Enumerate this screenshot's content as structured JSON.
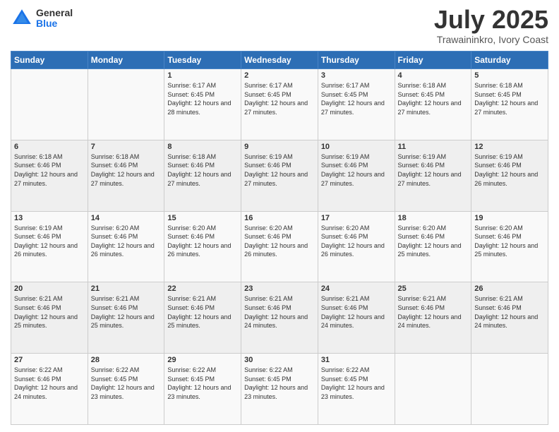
{
  "header": {
    "logo_general": "General",
    "logo_blue": "Blue",
    "month_title": "July 2025",
    "location": "Trawaininkro, Ivory Coast"
  },
  "calendar": {
    "days_of_week": [
      "Sunday",
      "Monday",
      "Tuesday",
      "Wednesday",
      "Thursday",
      "Friday",
      "Saturday"
    ],
    "weeks": [
      [
        {
          "day": "",
          "info": ""
        },
        {
          "day": "",
          "info": ""
        },
        {
          "day": "1",
          "info": "Sunrise: 6:17 AM\nSunset: 6:45 PM\nDaylight: 12 hours and 28 minutes."
        },
        {
          "day": "2",
          "info": "Sunrise: 6:17 AM\nSunset: 6:45 PM\nDaylight: 12 hours and 27 minutes."
        },
        {
          "day": "3",
          "info": "Sunrise: 6:17 AM\nSunset: 6:45 PM\nDaylight: 12 hours and 27 minutes."
        },
        {
          "day": "4",
          "info": "Sunrise: 6:18 AM\nSunset: 6:45 PM\nDaylight: 12 hours and 27 minutes."
        },
        {
          "day": "5",
          "info": "Sunrise: 6:18 AM\nSunset: 6:45 PM\nDaylight: 12 hours and 27 minutes."
        }
      ],
      [
        {
          "day": "6",
          "info": "Sunrise: 6:18 AM\nSunset: 6:46 PM\nDaylight: 12 hours and 27 minutes."
        },
        {
          "day": "7",
          "info": "Sunrise: 6:18 AM\nSunset: 6:46 PM\nDaylight: 12 hours and 27 minutes."
        },
        {
          "day": "8",
          "info": "Sunrise: 6:18 AM\nSunset: 6:46 PM\nDaylight: 12 hours and 27 minutes."
        },
        {
          "day": "9",
          "info": "Sunrise: 6:19 AM\nSunset: 6:46 PM\nDaylight: 12 hours and 27 minutes."
        },
        {
          "day": "10",
          "info": "Sunrise: 6:19 AM\nSunset: 6:46 PM\nDaylight: 12 hours and 27 minutes."
        },
        {
          "day": "11",
          "info": "Sunrise: 6:19 AM\nSunset: 6:46 PM\nDaylight: 12 hours and 27 minutes."
        },
        {
          "day": "12",
          "info": "Sunrise: 6:19 AM\nSunset: 6:46 PM\nDaylight: 12 hours and 26 minutes."
        }
      ],
      [
        {
          "day": "13",
          "info": "Sunrise: 6:19 AM\nSunset: 6:46 PM\nDaylight: 12 hours and 26 minutes."
        },
        {
          "day": "14",
          "info": "Sunrise: 6:20 AM\nSunset: 6:46 PM\nDaylight: 12 hours and 26 minutes."
        },
        {
          "day": "15",
          "info": "Sunrise: 6:20 AM\nSunset: 6:46 PM\nDaylight: 12 hours and 26 minutes."
        },
        {
          "day": "16",
          "info": "Sunrise: 6:20 AM\nSunset: 6:46 PM\nDaylight: 12 hours and 26 minutes."
        },
        {
          "day": "17",
          "info": "Sunrise: 6:20 AM\nSunset: 6:46 PM\nDaylight: 12 hours and 26 minutes."
        },
        {
          "day": "18",
          "info": "Sunrise: 6:20 AM\nSunset: 6:46 PM\nDaylight: 12 hours and 25 minutes."
        },
        {
          "day": "19",
          "info": "Sunrise: 6:20 AM\nSunset: 6:46 PM\nDaylight: 12 hours and 25 minutes."
        }
      ],
      [
        {
          "day": "20",
          "info": "Sunrise: 6:21 AM\nSunset: 6:46 PM\nDaylight: 12 hours and 25 minutes."
        },
        {
          "day": "21",
          "info": "Sunrise: 6:21 AM\nSunset: 6:46 PM\nDaylight: 12 hours and 25 minutes."
        },
        {
          "day": "22",
          "info": "Sunrise: 6:21 AM\nSunset: 6:46 PM\nDaylight: 12 hours and 25 minutes."
        },
        {
          "day": "23",
          "info": "Sunrise: 6:21 AM\nSunset: 6:46 PM\nDaylight: 12 hours and 24 minutes."
        },
        {
          "day": "24",
          "info": "Sunrise: 6:21 AM\nSunset: 6:46 PM\nDaylight: 12 hours and 24 minutes."
        },
        {
          "day": "25",
          "info": "Sunrise: 6:21 AM\nSunset: 6:46 PM\nDaylight: 12 hours and 24 minutes."
        },
        {
          "day": "26",
          "info": "Sunrise: 6:21 AM\nSunset: 6:46 PM\nDaylight: 12 hours and 24 minutes."
        }
      ],
      [
        {
          "day": "27",
          "info": "Sunrise: 6:22 AM\nSunset: 6:46 PM\nDaylight: 12 hours and 24 minutes."
        },
        {
          "day": "28",
          "info": "Sunrise: 6:22 AM\nSunset: 6:45 PM\nDaylight: 12 hours and 23 minutes."
        },
        {
          "day": "29",
          "info": "Sunrise: 6:22 AM\nSunset: 6:45 PM\nDaylight: 12 hours and 23 minutes."
        },
        {
          "day": "30",
          "info": "Sunrise: 6:22 AM\nSunset: 6:45 PM\nDaylight: 12 hours and 23 minutes."
        },
        {
          "day": "31",
          "info": "Sunrise: 6:22 AM\nSunset: 6:45 PM\nDaylight: 12 hours and 23 minutes."
        },
        {
          "day": "",
          "info": ""
        },
        {
          "day": "",
          "info": ""
        }
      ]
    ]
  }
}
